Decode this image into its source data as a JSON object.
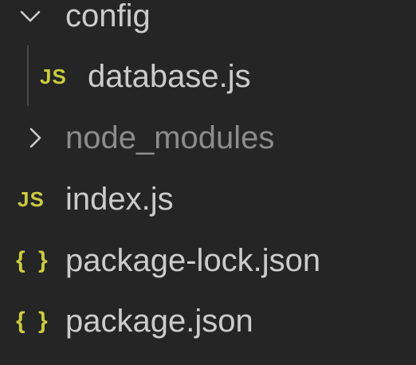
{
  "tree": {
    "folder_config": {
      "label": "config",
      "expanded_icon": "chevron-down-icon",
      "children": [
        {
          "label": "database.js",
          "icon": "js-file-icon",
          "icon_text": "JS"
        }
      ]
    },
    "folder_node_modules": {
      "label": "node_modules",
      "collapsed_icon": "chevron-right-icon"
    },
    "files": [
      {
        "label": "index.js",
        "icon": "js-file-icon",
        "icon_text": "JS"
      },
      {
        "label": "package-lock.json",
        "icon": "json-file-icon",
        "icon_text": "{ }"
      },
      {
        "label": "package.json",
        "icon": "json-file-icon",
        "icon_text": "{ }"
      }
    ]
  },
  "colors": {
    "background": "#252526",
    "text": "#cccccc",
    "text_dimmed": "#8c8c8c",
    "icon_yellow": "#cbcb41",
    "indent_guide": "#4a4a4a"
  }
}
